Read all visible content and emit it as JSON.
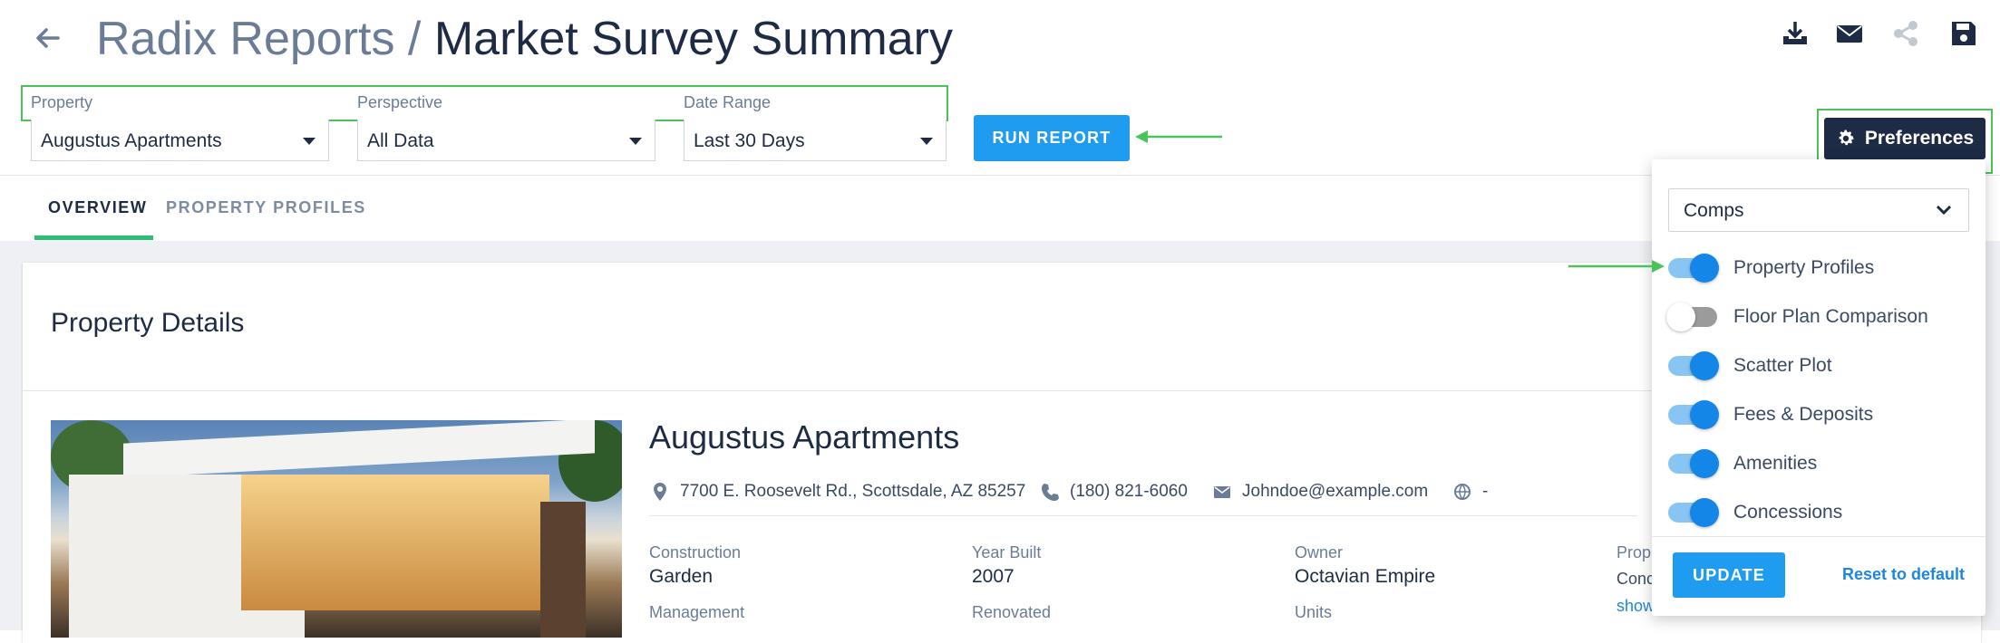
{
  "header": {
    "breadcrumb_root": "Radix Reports",
    "separator": "/",
    "title": "Market Survey Summary",
    "icons": [
      "download-icon",
      "email-icon",
      "share-icon",
      "save-icon"
    ]
  },
  "filters": {
    "property": {
      "label": "Property",
      "value": "Augustus Apartments"
    },
    "perspective": {
      "label": "Perspective",
      "value": "All Data"
    },
    "date_range": {
      "label": "Date Range",
      "value": "Last 30 Days"
    }
  },
  "run_report_label": "RUN REPORT",
  "preferences_label": "Preferences",
  "tabs": [
    {
      "label": "OVERVIEW",
      "active": true
    },
    {
      "label": "PROPERTY PROFILES",
      "active": false
    }
  ],
  "card": {
    "title": "Property Details",
    "property_name": "Augustus Apartments",
    "address": "7700 E. Roosevelt Rd., Scottsdale, AZ 85257",
    "phone": "(180) 821-6060",
    "email": "Johndoe@example.com",
    "website": "-",
    "details": [
      {
        "label": "Construction",
        "value": "Garden"
      },
      {
        "label": "Year Built",
        "value": "2007"
      },
      {
        "label": "Owner",
        "value": "Octavian Empire"
      },
      {
        "label": "Management",
        "value": ""
      },
      {
        "label": "Renovated",
        "value": ""
      },
      {
        "label": "Units",
        "value": ""
      }
    ],
    "partial_label": "Prop",
    "partial_text": "Conc",
    "partial_link": "show"
  },
  "preferences_panel": {
    "select_value": "Comps",
    "toggles": [
      {
        "label": "Property Profiles",
        "on": true
      },
      {
        "label": "Floor Plan Comparison",
        "on": false
      },
      {
        "label": "Scatter Plot",
        "on": true
      },
      {
        "label": "Fees & Deposits",
        "on": true
      },
      {
        "label": "Amenities",
        "on": true
      },
      {
        "label": "Concessions",
        "on": true
      }
    ],
    "update_label": "UPDATE",
    "reset_label": "Reset to default"
  },
  "colors": {
    "primary": "#1f9cef",
    "dark": "#1d2b45",
    "accent_tab": "#2ebd75",
    "annotation": "#4cc25a",
    "toggle_on": "#1386e8"
  }
}
